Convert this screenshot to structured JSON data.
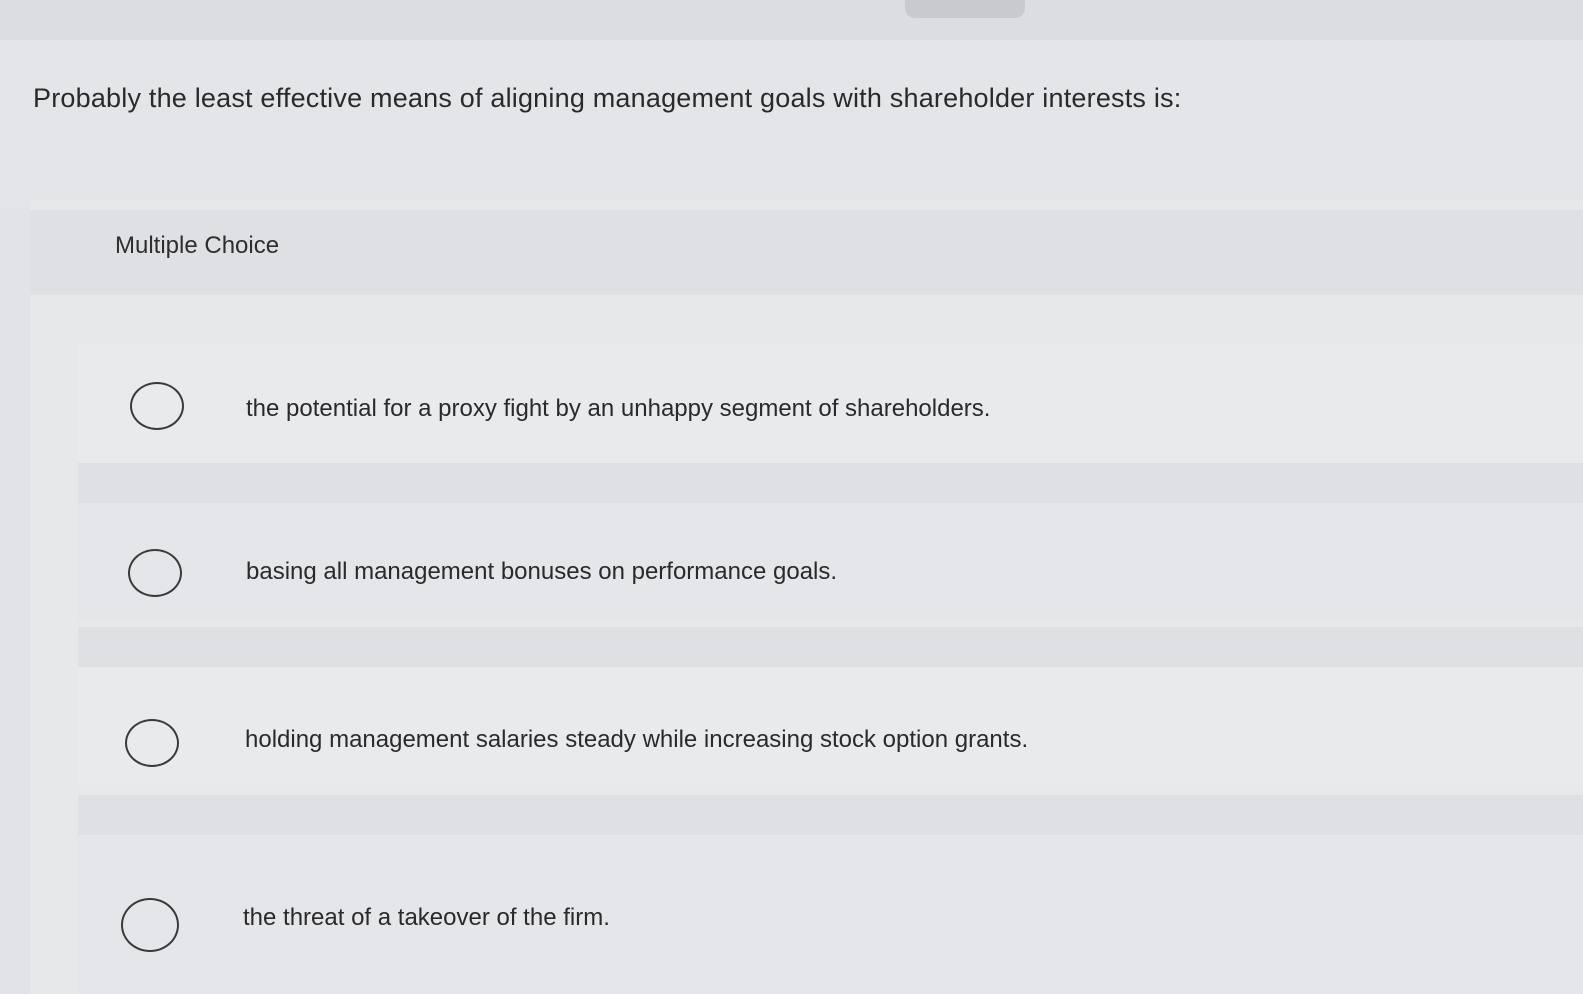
{
  "question": {
    "text": "Probably the least effective means of aligning management goals with shareholder interests is:"
  },
  "question_type": "Multiple Choice",
  "options": [
    {
      "label": "the potential for a proxy fight by an unhappy segment of shareholders.",
      "selected": false
    },
    {
      "label": "basing all management bonuses on performance goals.",
      "selected": false
    },
    {
      "label": "holding management salaries steady while increasing stock option grants.",
      "selected": false
    },
    {
      "label": "the threat of a takeover of the firm.",
      "selected": false
    }
  ]
}
